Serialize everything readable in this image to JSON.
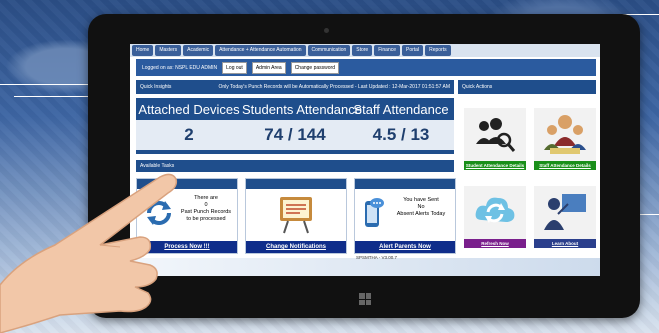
{
  "menu": [
    "Home",
    "Masters",
    "Academic",
    "Attendance + Attendance Automation",
    "Communication",
    "Store",
    "Finance",
    "Portal",
    "Reports"
  ],
  "userbar": {
    "logged_in": "Logged on as: NSPL EDU ADMIN",
    "logout": "Log out",
    "admin_area": "Admin Area",
    "change_password": "Change password"
  },
  "quick_insights": {
    "title": "Quick Insights",
    "notice": "Only Today's Punch Records will be Automatically Processed - Last Updated : 12-Mar-2017 01:51:57 AM"
  },
  "stats": [
    {
      "label": "Attached Devices",
      "value": "2"
    },
    {
      "label": "Students Attendance",
      "value": "74 / 144"
    },
    {
      "label": "Staff Attendance",
      "value": "4.5 / 13"
    }
  ],
  "available_tasks": {
    "title": "Available Tasks",
    "task1": {
      "line1": "There are",
      "line2": "0",
      "line3": "Past Punch Records",
      "line4": "to be processed",
      "button": "Process Now !!!"
    },
    "task2": {
      "button": "Change Notifications"
    },
    "task3": {
      "line1": "You have Sent",
      "line2": "No",
      "line3": "Absent Alerts Today",
      "button": "Alert Parents Now"
    }
  },
  "quick_actions": {
    "title": "Quick Actions",
    "items": [
      {
        "label": "Student Attendance Details",
        "color": "#1a8f1a"
      },
      {
        "label": "Staff Attendance Details",
        "color": "#1a8f1a"
      },
      {
        "label": "Refresh Now",
        "color": "#7a1f8c"
      },
      {
        "label": "Learn About",
        "color": "#2b3f8c"
      }
    ]
  },
  "footer": "SPSMTHA - V3.00.7",
  "colors": {
    "primary": "#1f4e8c",
    "button": "#0f2d8a"
  }
}
